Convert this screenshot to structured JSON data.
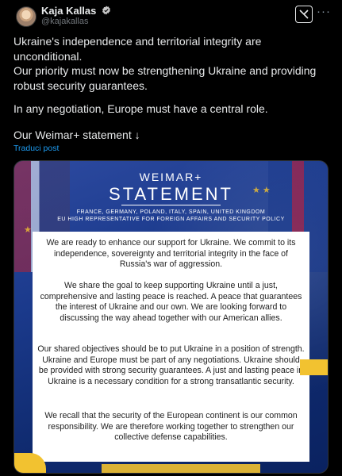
{
  "author": {
    "name": "Kaja Kallas",
    "handle": "@kajakallas"
  },
  "post": {
    "paragraphs": [
      "Ukraine's independence and territorial integrity are unconditional.",
      "Our priority must now be strengthening Ukraine and providing robust security guarantees.",
      "In any negotiation, Europe must have a central role.",
      "Our Weimar+ statement ↓"
    ],
    "translate_label": "Traduci post"
  },
  "image": {
    "heading_small": "WEIMAR+",
    "heading_large": "STATEMENT",
    "countries": "FRANCE, GERMANY, POLAND, ITALY, SPAIN, UNITED KINGDOM",
    "representative": "EU HIGH REPRESENTATIVE FOR FOREIGN AFFAIRS AND SECURITY POLICY",
    "statement_paragraphs": [
      "We are ready to enhance our support for Ukraine. We commit to its independence, sovereignty and territorial integrity in the face of Russia's war of aggression.",
      "We share the goal to keep supporting Ukraine until a just, comprehensive and lasting peace is reached. A peace that guarantees the interest of Ukraine and our own. We are looking forward to discussing the way ahead together with our American allies.",
      "Our shared objectives should be to put Ukraine in a position of strength. Ukraine and Europe must be part of any negotiations. Ukraine should be provided with strong security guarantees. A just and lasting peace in Ukraine is a necessary condition for a strong transatlantic security.",
      "We recall that the security of the European continent is our common responsibility. We are therefore working together to strengthen our collective defense capabilities."
    ]
  },
  "icons": {
    "verified": "verified-badge-icon",
    "grok": "grok-icon",
    "more": "more-icon"
  },
  "colors": {
    "background": "#000000",
    "link": "#1d9bf0",
    "eu_blue": "#1b3a8c",
    "eu_yellow": "#f2c230"
  }
}
